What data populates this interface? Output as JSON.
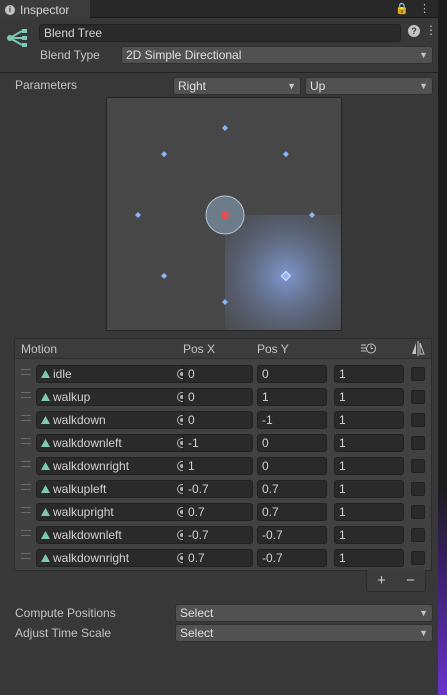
{
  "tab": {
    "title": "Inspector"
  },
  "header": {
    "name": "Blend Tree",
    "blend_type_label": "Blend Type",
    "blend_type_value": "2D Simple Directional"
  },
  "parameters": {
    "label": "Parameters",
    "x_param": "Right",
    "y_param": "Up"
  },
  "visualization": {
    "points": [
      {
        "x": 0,
        "y": 0
      },
      {
        "x": 0,
        "y": 1
      },
      {
        "x": 0,
        "y": -1
      },
      {
        "x": -1,
        "y": 0
      },
      {
        "x": 1,
        "y": 0
      },
      {
        "x": -0.7,
        "y": 0.7
      },
      {
        "x": 0.7,
        "y": 0.7
      },
      {
        "x": -0.7,
        "y": -0.7
      },
      {
        "x": 0.7,
        "y": -0.7
      }
    ],
    "selected_index": 8,
    "colors": {
      "point": "#8cb4ff",
      "current": "#e05050",
      "bg": "#474747"
    }
  },
  "table": {
    "headers": {
      "motion": "Motion",
      "pos_x": "Pos X",
      "pos_y": "Pos Y"
    },
    "rows": [
      {
        "motion": "idle",
        "x": "0",
        "y": "0",
        "speed": "1"
      },
      {
        "motion": "walkup",
        "x": "0",
        "y": "1",
        "speed": "1"
      },
      {
        "motion": "walkdown",
        "x": "0",
        "y": "-1",
        "speed": "1"
      },
      {
        "motion": "walkdownleft",
        "x": "-1",
        "y": "0",
        "speed": "1"
      },
      {
        "motion": "walkdownright",
        "x": "1",
        "y": "0",
        "speed": "1"
      },
      {
        "motion": "walkupleft",
        "x": "-0.7",
        "y": "0.7",
        "speed": "1"
      },
      {
        "motion": "walkupright",
        "x": "0.7",
        "y": "0.7",
        "speed": "1"
      },
      {
        "motion": "walkdownleft",
        "x": "-0.7",
        "y": "-0.7",
        "speed": "1"
      },
      {
        "motion": "walkdownright",
        "x": "0.7",
        "y": "-0.7",
        "speed": "1"
      }
    ]
  },
  "buttons": {
    "add": "+",
    "remove": "−"
  },
  "compute_positions": {
    "label": "Compute Positions",
    "value": "Select"
  },
  "adjust_time_scale": {
    "label": "Adjust Time Scale",
    "value": "Select"
  }
}
